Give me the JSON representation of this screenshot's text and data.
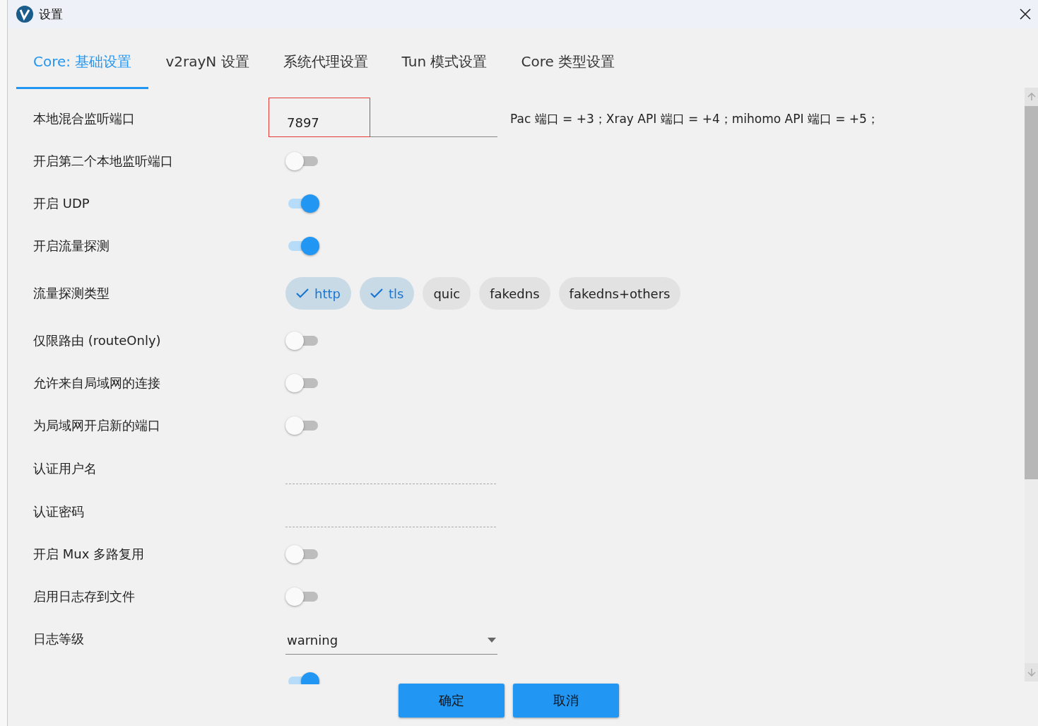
{
  "window": {
    "title": "设置"
  },
  "tabs": [
    {
      "label": "Core: 基础设置",
      "selected": true
    },
    {
      "label": "v2rayN 设置",
      "selected": false
    },
    {
      "label": "系统代理设置",
      "selected": false
    },
    {
      "label": "Tun 模式设置",
      "selected": false
    },
    {
      "label": "Core 类型设置",
      "selected": false
    }
  ],
  "rows": [
    {
      "kind": "port",
      "label": "本地混合监听端口",
      "value": "7897",
      "highlighted": true,
      "hint": "Pac 端口 = +3；Xray API 端口 = +4；mihomo API 端口 = +5；"
    },
    {
      "kind": "switch",
      "label": "开启第二个本地监听端口",
      "on": false
    },
    {
      "kind": "switch",
      "label": "开启 UDP",
      "on": true
    },
    {
      "kind": "switch",
      "label": "开启流量探测",
      "on": true
    },
    {
      "kind": "chips",
      "label": "流量探测类型",
      "chips": [
        {
          "label": "http",
          "selected": true
        },
        {
          "label": "tls",
          "selected": true
        },
        {
          "label": "quic",
          "selected": false
        },
        {
          "label": "fakedns",
          "selected": false
        },
        {
          "label": "fakedns+others",
          "selected": false
        }
      ]
    },
    {
      "kind": "switch",
      "label": "仅限路由 (routeOnly)",
      "on": false
    },
    {
      "kind": "switch",
      "label": "允许来自局域网的连接",
      "on": false
    },
    {
      "kind": "switch",
      "label": "为局域网开启新的端口",
      "on": false
    },
    {
      "kind": "text",
      "label": "认证用户名"
    },
    {
      "kind": "text",
      "label": "认证密码"
    },
    {
      "kind": "switch",
      "label": "开启 Mux 多路复用",
      "on": false
    },
    {
      "kind": "switch",
      "label": "启用日志存到文件",
      "on": false
    },
    {
      "kind": "select",
      "label": "日志等级",
      "value": "warning"
    },
    {
      "kind": "switch",
      "on": true
    }
  ],
  "buttons": [
    "确定",
    "取消"
  ]
}
